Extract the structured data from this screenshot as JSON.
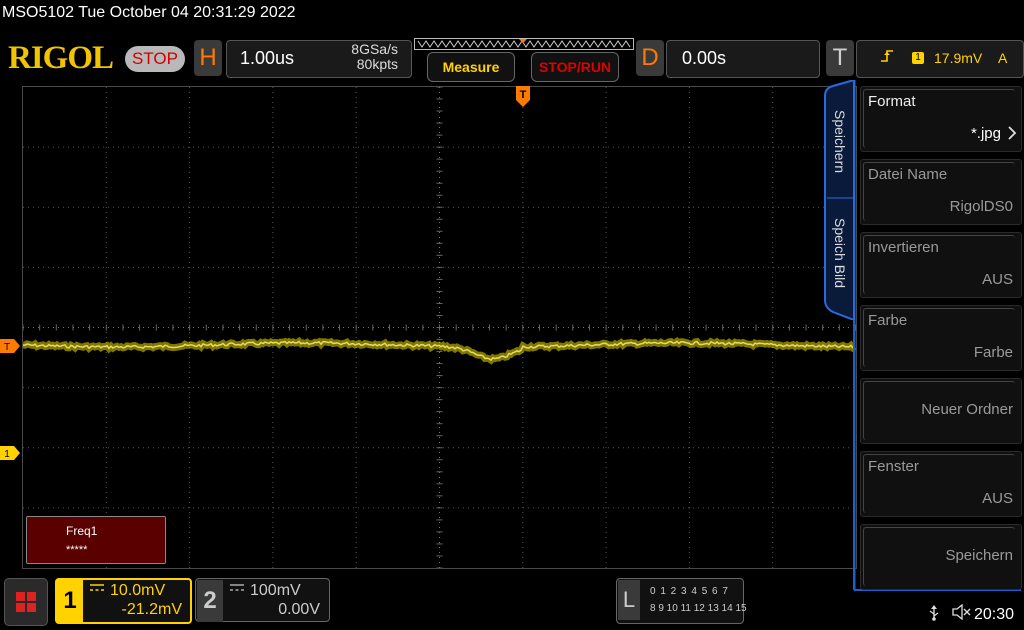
{
  "status": {
    "text": "MSO5102  Tue October 04 20:31:29 2022"
  },
  "header": {
    "logo": "RIGOL",
    "run_state": "STOP",
    "horizontal": {
      "letter": "H",
      "timebase": "1.00us",
      "sample_rate": "8GSa/s",
      "memory_depth": "80kpts"
    },
    "measure_label": "Measure",
    "stop_run_label": "STOP/RUN",
    "delay": {
      "letter": "D",
      "value": "0.00s"
    },
    "trigger": {
      "letter": "T",
      "level": "17.9mV",
      "mode": "A",
      "source": "1",
      "edge_icon": "rising-edge-icon"
    }
  },
  "markers": {
    "trigger_position": "T",
    "trigger_level": "T",
    "ch1": "1"
  },
  "measurement": {
    "name": "Freq1",
    "value": "*****"
  },
  "menu": {
    "tabs": [
      "Speichern",
      "Speich Bild"
    ],
    "items": [
      {
        "name": "Format",
        "value": "*.jpg",
        "active": true
      },
      {
        "name": "Datei Name",
        "value": "RigolDS0",
        "active": false
      },
      {
        "name": "Invertieren",
        "value": "AUS",
        "active": false
      },
      {
        "name": "Farbe",
        "value": "Farbe",
        "active": false
      },
      {
        "name": "",
        "value": "Neuer Ordner",
        "active": false
      },
      {
        "name": "Fenster",
        "value": "AUS",
        "active": false
      },
      {
        "name": "",
        "value": "Speichern",
        "active": false
      }
    ]
  },
  "channels": [
    {
      "number": "1",
      "scale": "10.0mV",
      "offset": "-21.2mV",
      "color": "#ffd200",
      "coupling": "DC"
    },
    {
      "number": "2",
      "scale": "100mV",
      "offset": "0.00V",
      "color": "#cccccc",
      "coupling": "DC"
    }
  ],
  "logic_analyzer": {
    "letter": "L",
    "row1": "0 1 2 3  4 5 6 7",
    "row2": "8 9 10 11 12 13 14 15"
  },
  "footer": {
    "time": "20:30"
  },
  "colors": {
    "trace": "#f0e000",
    "accent": "#ff7a00",
    "menu_border": "#1e5fd0",
    "logo": "#f0c400"
  }
}
